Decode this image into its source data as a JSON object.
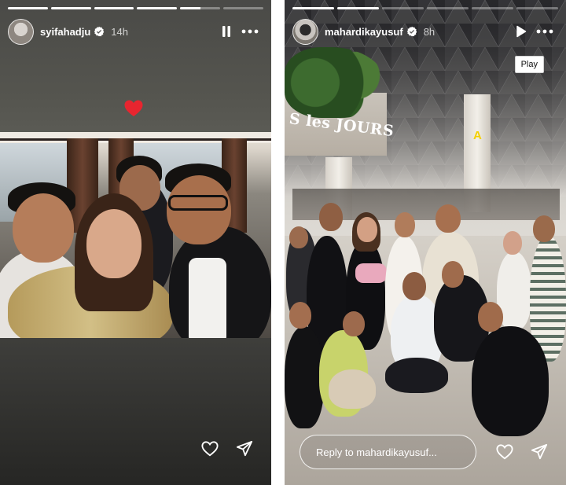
{
  "left_story": {
    "username": "syifahadju",
    "time": "14h",
    "progress": [
      1,
      1,
      1,
      1,
      0.5,
      0
    ],
    "pause_icon": "pause-icon",
    "more_icon": "more-horizontal-icon",
    "sticker_icon": "red-heart-emoji",
    "actions": {
      "like_icon": "heart-outline-icon",
      "share_icon": "send-icon"
    }
  },
  "right_story": {
    "username": "mahardikayusuf",
    "time": "8h",
    "progress": [
      1,
      1,
      0,
      0,
      0,
      0
    ],
    "play_icon": "play-icon",
    "more_icon": "more-horizontal-icon",
    "tooltip": "Play",
    "photo_text": {
      "store_sign": "S les JOURS",
      "gate_sign": "A"
    },
    "reply_placeholder": "Reply to mahardikayusuf...",
    "actions": {
      "like_icon": "heart-outline-icon",
      "share_icon": "send-icon"
    }
  },
  "colors": {
    "verified_badge": "#0095f6",
    "heart_sticker": "#e8252f",
    "gate_sign": "#f4d000"
  }
}
